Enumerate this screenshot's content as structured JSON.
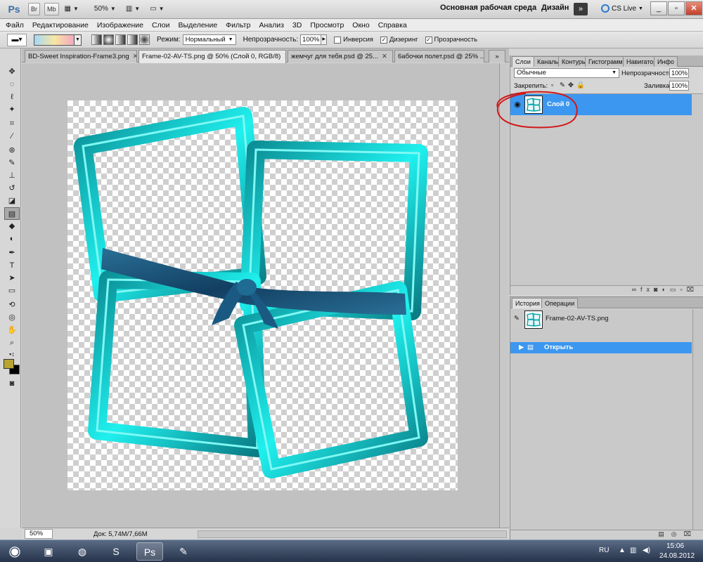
{
  "app": {
    "logo": "Ps",
    "bridge_btn": "Br",
    "minibridge_btn": "Mb",
    "zoom_level": "50%",
    "workspace": "Основная рабочая среда",
    "design": "Дизайн",
    "cs_live": "CS Live"
  },
  "menu": [
    "Файл",
    "Редактирование",
    "Изображение",
    "Слои",
    "Выделение",
    "Фильтр",
    "Анализ",
    "3D",
    "Просмотр",
    "Окно",
    "Справка"
  ],
  "options": {
    "mode_label": "Режим:",
    "mode_value": "Нормальный",
    "opacity_label": "Непрозрачность:",
    "opacity_value": "100%",
    "inverse_label": "Инверсия",
    "dither_label": "Дизеринг",
    "transparency_label": "Прозрачность"
  },
  "tabs": [
    {
      "label": "BD-Sweet Inspiration-Frame3.png",
      "active": false
    },
    {
      "label": "Frame-02-AV-TS.png @ 50% (Слой 0, RGB/8)",
      "active": true
    },
    {
      "label": "жемчуг для тебя.psd @ 25...",
      "active": false
    },
    {
      "label": "6абочки полет.psd @ 25% ...",
      "active": false
    }
  ],
  "status": {
    "zoom": "50%",
    "doc_info": "Док: 5,74M/7,66M"
  },
  "layers_panel": {
    "tabs": [
      "Слои",
      "Каналы",
      "Контуры",
      "Гистограмма",
      "Навигатор",
      "Инфо"
    ],
    "blend_mode": "Обычные",
    "opacity_label": "Непрозрачность:",
    "opacity_value": "100%",
    "lock_label": "Закрепить:",
    "fill_label": "Заливка:",
    "fill_value": "100%",
    "layer_name": "Слой 0"
  },
  "history_panel": {
    "tabs": [
      "История",
      "Операции"
    ],
    "snapshot": "Frame-02-AV-TS.png",
    "item": "Открыть"
  },
  "taskbar": {
    "lang": "RU",
    "time": "15:06",
    "date": "24.08.2012"
  },
  "colors": {
    "accent": "#3c97f0",
    "frame": "#12c9c9",
    "ribbon": "#1b5a7e",
    "foreground": "#b8a432",
    "background": "#000000",
    "annotation": "#d01818"
  }
}
